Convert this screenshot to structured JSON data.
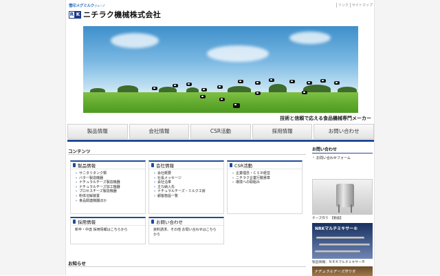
{
  "header": {
    "group_logo": "雪印メグミルク",
    "group_suffix": "グループ",
    "rk_letters": [
      "R",
      "K"
    ],
    "company_name": "ニチラク機械株式会社",
    "top_links": [
      "リンク",
      "サイトマップ"
    ]
  },
  "hero": {
    "tagline": "技術と信頼で応える食品機械専門メーカー"
  },
  "nav": {
    "items": [
      "製品情報",
      "会社情報",
      "CSR活動",
      "採用情報",
      "お問い合わせ"
    ]
  },
  "contents": {
    "title": "コンテンツ",
    "products": {
      "heading": "製品情報",
      "items": [
        "サニタリタンク類",
        "バター製造機器",
        "ナチュラルチーズ製造機器",
        "ナチュラルチーズ加工機器",
        "プロセスチーズ製造機器",
        "粉体溶解装置",
        "食品関連機器ほか"
      ]
    },
    "company": {
      "heading": "会社情報",
      "items": [
        "会社概要",
        "社長メッセージ",
        "会社沿革",
        "主な納入先",
        "ナチュラルチーズ・ミルク工房",
        "顧客施設一覧"
      ]
    },
    "csr": {
      "heading": "CSR活動",
      "items": [
        "企業理念・ＣＳＲ経営",
        "ニチラク企業行動憲章",
        "環境への取組み"
      ]
    },
    "recruit": {
      "heading": "採用情報",
      "text": "新卒・中途 採用情報はこちらから"
    },
    "contact": {
      "heading": "お問い合わせ",
      "text": "資料請求、その他 お問い合わせはこちらから"
    }
  },
  "news": {
    "title": "お知らせ"
  },
  "sidebar": {
    "title": "お問い合わせ",
    "form_link": "お問い合わせフォーム",
    "caption1": "チーズ作り　【動画】",
    "banner_title": "NRKマルチミキサー®",
    "caption2": "製品情報：ＮＲＫマルチミキサー®",
    "banner2_title": "ナチュラルチーズ作りを"
  },
  "colors": {
    "accent": "#1f4a96",
    "field": "#5ea82c",
    "sky": "#3e8fcb"
  }
}
